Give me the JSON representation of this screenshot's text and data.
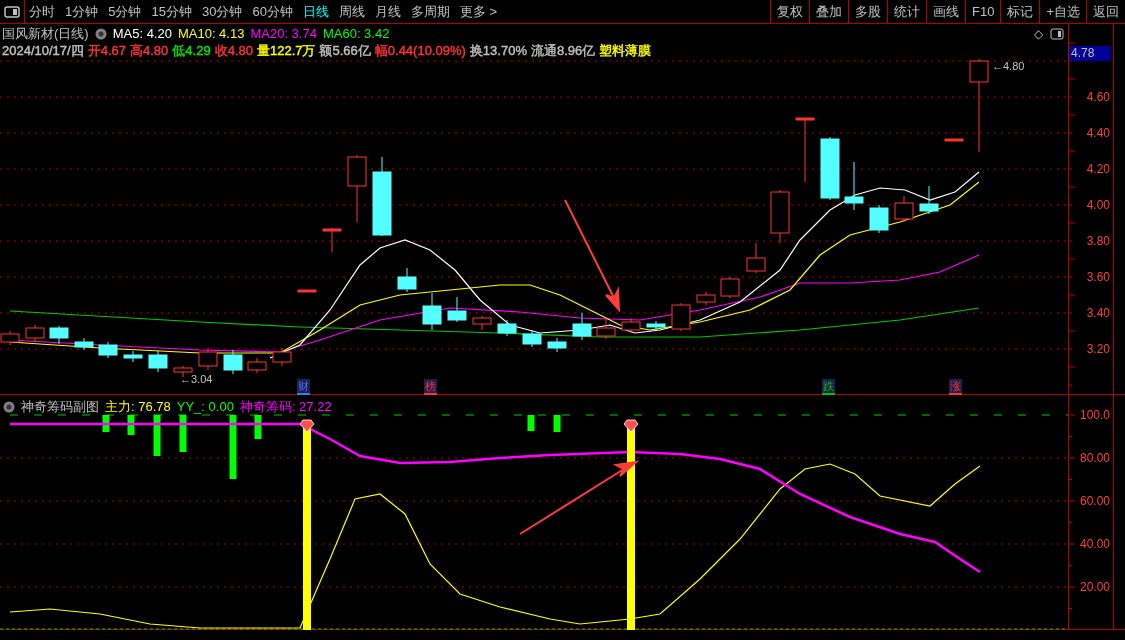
{
  "toolbar": {
    "periods": [
      {
        "label": "分时",
        "selected": false
      },
      {
        "label": "1分钟",
        "selected": false
      },
      {
        "label": "5分钟",
        "selected": false
      },
      {
        "label": "15分钟",
        "selected": false
      },
      {
        "label": "30分钟",
        "selected": false
      },
      {
        "label": "60分钟",
        "selected": false
      },
      {
        "label": "日线",
        "selected": true
      },
      {
        "label": "周线",
        "selected": false
      },
      {
        "label": "月线",
        "selected": false
      },
      {
        "label": "多周期",
        "selected": false
      }
    ],
    "more": "更多 >",
    "buttons": [
      "复权",
      "叠加",
      "多股",
      "统计",
      "画线",
      "F10",
      "标记",
      "+自选",
      "返回"
    ]
  },
  "main_chart": {
    "title": "国风新材(日线)",
    "moving_averages": [
      {
        "label": "MA5: 4.20",
        "color": "#ffffff"
      },
      {
        "label": "MA10: 4.13",
        "color": "#ffff00"
      },
      {
        "label": "MA20: 3.74",
        "color": "#ff00ff"
      },
      {
        "label": "MA60: 3.42",
        "color": "#00ff00"
      }
    ],
    "quote": [
      {
        "text": "2024/10/17/四",
        "color": "#c0c0c0"
      },
      {
        "text": "开4.67",
        "color": "#ff3232"
      },
      {
        "text": "高4.80",
        "color": "#ff3232"
      },
      {
        "text": "低4.29",
        "color": "#00e600"
      },
      {
        "text": "收4.80",
        "color": "#ff3232"
      },
      {
        "text": "量122.7万",
        "color": "#ffff00"
      },
      {
        "text": "额5.66亿",
        "color": "#c0c0c0"
      },
      {
        "text": "幅0.44(10.09%)",
        "color": "#ff3232"
      },
      {
        "text": "换13.70%",
        "color": "#c0c0c0"
      },
      {
        "text": "流通8.96亿",
        "color": "#c0c0c0"
      },
      {
        "text": "塑料薄膜",
        "color": "#ffff00"
      }
    ],
    "diamond": "◇",
    "current_price": "4.78",
    "high_label": "←4.80",
    "low_label": "←3.04",
    "y_ticks": [
      "4.60",
      "4.40",
      "4.20",
      "4.00",
      "3.80",
      "3.60",
      "3.40",
      "3.20"
    ],
    "event_markers": [
      {
        "text": "财",
        "color": "#3c78ff"
      },
      {
        "text": "榜",
        "color": "#ff3232"
      },
      {
        "text": "跌",
        "color": "#00c800"
      },
      {
        "text": "涨",
        "color": "#ff3232"
      }
    ]
  },
  "sub_chart": {
    "title": "神奇筹码副图",
    "indicators": [
      {
        "label": "主力: 76.78",
        "color": "#ffff00"
      },
      {
        "label": "YY_: 0.00",
        "color": "#00ff00"
      },
      {
        "label": "神奇筹码: 27.22",
        "color": "#ff00ff"
      }
    ],
    "y_ticks": [
      "100.0",
      "80.00",
      "60.00",
      "40.00",
      "20.00"
    ]
  }
}
